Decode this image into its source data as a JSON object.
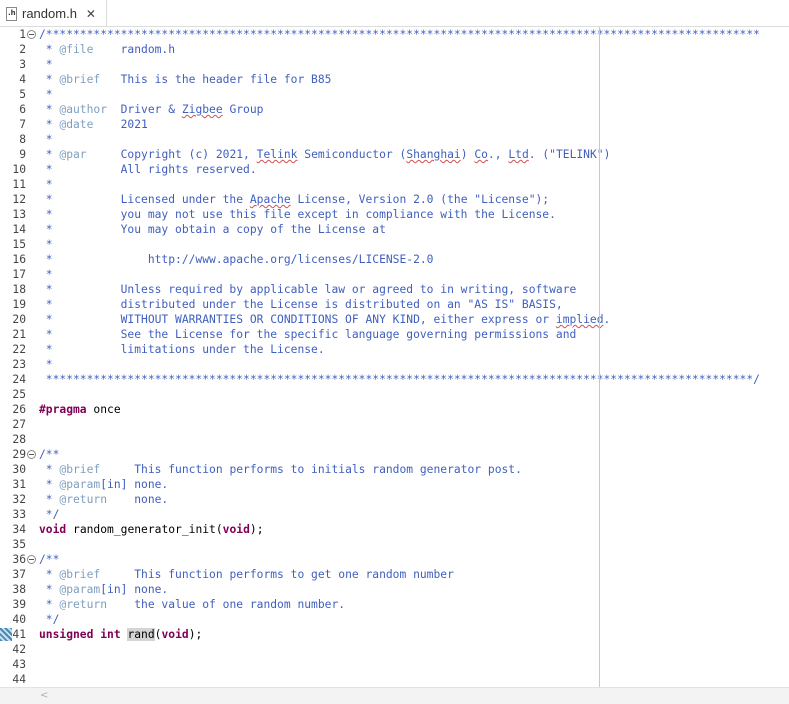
{
  "tab": {
    "icon_text": ".h",
    "title": "random.h",
    "close_glyph": "✕"
  },
  "editor": {
    "lines": [
      {
        "n": "1",
        "fold": true,
        "segs": [
          {
            "t": "/*********************************************************************************************************",
            "c": "cm"
          }
        ]
      },
      {
        "n": "2",
        "segs": [
          {
            "t": " * ",
            "c": "cm"
          },
          {
            "t": "@file",
            "c": "dt"
          },
          {
            "t": "    random.h",
            "c": "cm"
          }
        ]
      },
      {
        "n": "3",
        "segs": [
          {
            "t": " *",
            "c": "cm"
          }
        ]
      },
      {
        "n": "4",
        "segs": [
          {
            "t": " * ",
            "c": "cm"
          },
          {
            "t": "@brief",
            "c": "dt"
          },
          {
            "t": "   This is the header file for B85",
            "c": "cm"
          }
        ]
      },
      {
        "n": "5",
        "segs": [
          {
            "t": " *",
            "c": "cm"
          }
        ]
      },
      {
        "n": "6",
        "segs": [
          {
            "t": " * ",
            "c": "cm"
          },
          {
            "t": "@author",
            "c": "dt"
          },
          {
            "t": "  Driver & ",
            "c": "cm"
          },
          {
            "t": "Zigbee",
            "c": "cm sq"
          },
          {
            "t": " Group",
            "c": "cm"
          }
        ]
      },
      {
        "n": "7",
        "segs": [
          {
            "t": " * ",
            "c": "cm"
          },
          {
            "t": "@date",
            "c": "dt"
          },
          {
            "t": "    2021",
            "c": "cm"
          }
        ]
      },
      {
        "n": "8",
        "segs": [
          {
            "t": " *",
            "c": "cm"
          }
        ]
      },
      {
        "n": "9",
        "segs": [
          {
            "t": " * ",
            "c": "cm"
          },
          {
            "t": "@par",
            "c": "dt"
          },
          {
            "t": "     Copyright (c) 2021, ",
            "c": "cm"
          },
          {
            "t": "Telink",
            "c": "cm sq"
          },
          {
            "t": " Semiconductor (",
            "c": "cm"
          },
          {
            "t": "Shanghai",
            "c": "cm sq"
          },
          {
            "t": ") ",
            "c": "cm"
          },
          {
            "t": "Co",
            "c": "cm sq"
          },
          {
            "t": "., ",
            "c": "cm"
          },
          {
            "t": "Ltd",
            "c": "cm sq"
          },
          {
            "t": ". (\"TELINK\")",
            "c": "cm"
          }
        ]
      },
      {
        "n": "10",
        "segs": [
          {
            "t": " *          All rights reserved.",
            "c": "cm"
          }
        ]
      },
      {
        "n": "11",
        "segs": [
          {
            "t": " *",
            "c": "cm"
          }
        ]
      },
      {
        "n": "12",
        "segs": [
          {
            "t": " *          Licensed under the ",
            "c": "cm"
          },
          {
            "t": "Apache",
            "c": "cm sq"
          },
          {
            "t": " License, Version 2.0 (the \"License\");",
            "c": "cm"
          }
        ]
      },
      {
        "n": "13",
        "segs": [
          {
            "t": " *          you may not use this file except in compliance with the License.",
            "c": "cm"
          }
        ]
      },
      {
        "n": "14",
        "segs": [
          {
            "t": " *          You may obtain a copy of the License at",
            "c": "cm"
          }
        ]
      },
      {
        "n": "15",
        "segs": [
          {
            "t": " *",
            "c": "cm"
          }
        ]
      },
      {
        "n": "16",
        "segs": [
          {
            "t": " *              http://www.apache.org/licenses/LICENSE-2.0",
            "c": "cm"
          }
        ]
      },
      {
        "n": "17",
        "segs": [
          {
            "t": " *",
            "c": "cm"
          }
        ]
      },
      {
        "n": "18",
        "segs": [
          {
            "t": " *          Unless required by applicable law or agreed to in writing, software",
            "c": "cm"
          }
        ]
      },
      {
        "n": "19",
        "segs": [
          {
            "t": " *          distributed under the License is distributed on an \"AS IS\" BASIS,",
            "c": "cm"
          }
        ]
      },
      {
        "n": "20",
        "segs": [
          {
            "t": " *          WITHOUT WARRANTIES OR CONDITIONS OF ANY KIND, either express or ",
            "c": "cm"
          },
          {
            "t": "implied",
            "c": "cm sq"
          },
          {
            "t": ".",
            "c": "cm"
          }
        ]
      },
      {
        "n": "21",
        "segs": [
          {
            "t": " *          See the License for the specific language governing permissions and",
            "c": "cm"
          }
        ]
      },
      {
        "n": "22",
        "segs": [
          {
            "t": " *          limitations under the License.",
            "c": "cm"
          }
        ]
      },
      {
        "n": "23",
        "segs": [
          {
            "t": " *",
            "c": "cm"
          }
        ]
      },
      {
        "n": "24",
        "segs": [
          {
            "t": " ********************************************************************************************************/",
            "c": "cm"
          }
        ]
      },
      {
        "n": "25",
        "segs": []
      },
      {
        "n": "26",
        "segs": [
          {
            "t": "#pragma",
            "c": "kw"
          },
          {
            "t": " once",
            "c": ""
          }
        ]
      },
      {
        "n": "27",
        "segs": []
      },
      {
        "n": "28",
        "segs": []
      },
      {
        "n": "29",
        "fold": true,
        "segs": [
          {
            "t": "/**",
            "c": "cm"
          }
        ]
      },
      {
        "n": "30",
        "segs": [
          {
            "t": " * ",
            "c": "cm"
          },
          {
            "t": "@brief",
            "c": "dt"
          },
          {
            "t": "     This function performs to initials random generator post.",
            "c": "cm"
          }
        ]
      },
      {
        "n": "31",
        "segs": [
          {
            "t": " * ",
            "c": "cm"
          },
          {
            "t": "@param",
            "c": "dt"
          },
          {
            "t": "[in] none.",
            "c": "cm"
          }
        ]
      },
      {
        "n": "32",
        "segs": [
          {
            "t": " * ",
            "c": "cm"
          },
          {
            "t": "@return",
            "c": "dt"
          },
          {
            "t": "    none.",
            "c": "cm"
          }
        ]
      },
      {
        "n": "33",
        "segs": [
          {
            "t": " */",
            "c": "cm"
          }
        ]
      },
      {
        "n": "34",
        "segs": [
          {
            "t": "void",
            "c": "kw"
          },
          {
            "t": " ",
            "c": ""
          },
          {
            "t": "random_generator_init",
            "c": "fn"
          },
          {
            "t": "(",
            "c": ""
          },
          {
            "t": "void",
            "c": "kw"
          },
          {
            "t": ");",
            "c": ""
          }
        ]
      },
      {
        "n": "35",
        "segs": []
      },
      {
        "n": "36",
        "fold": true,
        "segs": [
          {
            "t": "/**",
            "c": "cm"
          }
        ]
      },
      {
        "n": "37",
        "segs": [
          {
            "t": " * ",
            "c": "cm"
          },
          {
            "t": "@brief",
            "c": "dt"
          },
          {
            "t": "     This function performs to get one random number",
            "c": "cm"
          }
        ]
      },
      {
        "n": "38",
        "segs": [
          {
            "t": " * ",
            "c": "cm"
          },
          {
            "t": "@param",
            "c": "dt"
          },
          {
            "t": "[in] none.",
            "c": "cm"
          }
        ]
      },
      {
        "n": "39",
        "segs": [
          {
            "t": " * ",
            "c": "cm"
          },
          {
            "t": "@return",
            "c": "dt"
          },
          {
            "t": "    the value of one random number.",
            "c": "cm"
          }
        ]
      },
      {
        "n": "40",
        "segs": [
          {
            "t": " */",
            "c": "cm"
          }
        ]
      },
      {
        "n": "41",
        "marker": true,
        "segs": [
          {
            "t": "unsigned",
            "c": "kw"
          },
          {
            "t": " ",
            "c": ""
          },
          {
            "t": "int",
            "c": "kw"
          },
          {
            "t": " ",
            "c": ""
          },
          {
            "t": "rand",
            "c": "fn hl"
          },
          {
            "t": "(",
            "c": ""
          },
          {
            "t": "void",
            "c": "kw"
          },
          {
            "t": ");",
            "c": ""
          }
        ]
      },
      {
        "n": "42",
        "segs": []
      },
      {
        "n": "43",
        "segs": []
      },
      {
        "n": "44",
        "segs": []
      }
    ]
  },
  "scrollbar": {
    "left_arrow": "<"
  },
  "colors": {
    "comment": "#3f5fbf",
    "doctag": "#7f9fbf",
    "keyword": "#7f0055",
    "text": "#000000",
    "linenumber": "#444444"
  }
}
